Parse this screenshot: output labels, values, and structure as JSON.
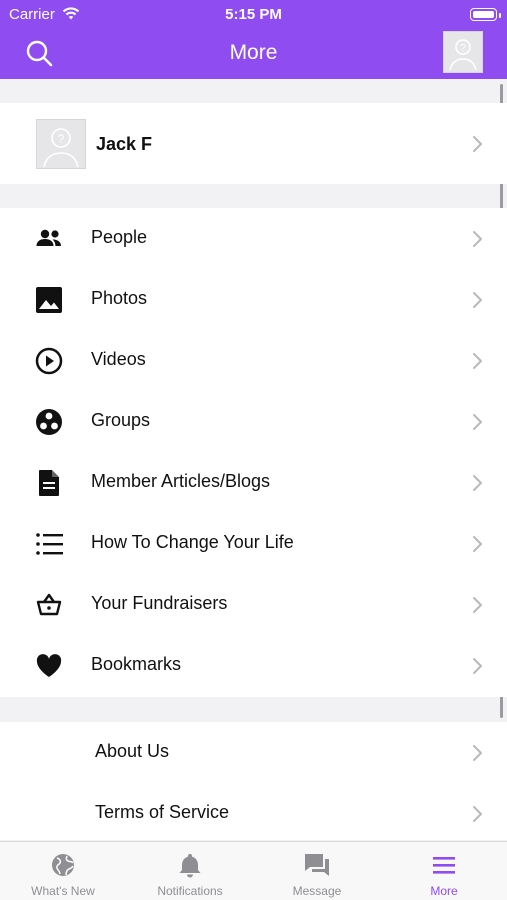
{
  "status_bar": {
    "carrier": "Carrier",
    "time": "5:15 PM"
  },
  "nav": {
    "title": "More"
  },
  "profile": {
    "name": "Jack F"
  },
  "menu_items": [
    {
      "label": "People",
      "icon": "people-icon"
    },
    {
      "label": "Photos",
      "icon": "photos-icon"
    },
    {
      "label": "Videos",
      "icon": "videos-icon"
    },
    {
      "label": "Groups",
      "icon": "groups-icon"
    },
    {
      "label": "Member Articles/Blogs",
      "icon": "document-icon"
    },
    {
      "label": "How To Change Your Life",
      "icon": "list-icon"
    },
    {
      "label": "Your Fundraisers",
      "icon": "basket-icon"
    },
    {
      "label": "Bookmarks",
      "icon": "heart-icon"
    }
  ],
  "secondary_items": [
    {
      "label": "About Us"
    },
    {
      "label": "Terms of Service"
    }
  ],
  "tabs": [
    {
      "label": "What's New",
      "icon": "globe-icon",
      "active": false
    },
    {
      "label": "Notifications",
      "icon": "bell-icon",
      "active": false
    },
    {
      "label": "Message",
      "icon": "message-icon",
      "active": false
    },
    {
      "label": "More",
      "icon": "menu-icon",
      "active": true
    }
  ],
  "colors": {
    "brand": "#8f4cf1",
    "inactive_tab": "#8e8e93"
  }
}
